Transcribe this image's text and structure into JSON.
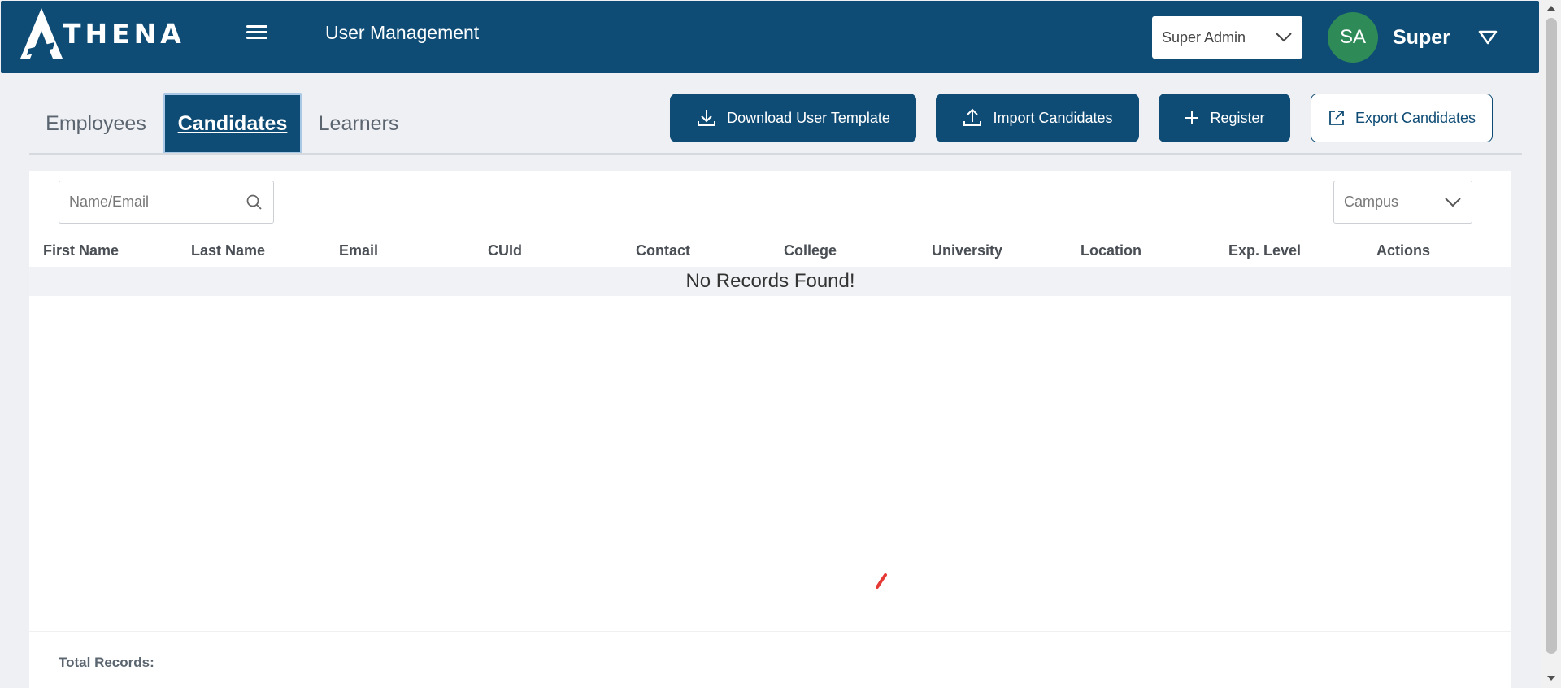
{
  "header": {
    "logo_text": "THENA",
    "title": "User Management",
    "role_select": {
      "value": "Super Admin"
    },
    "avatar_initials": "SA",
    "user_name": "Super"
  },
  "tabs": [
    {
      "label": "Employees",
      "active": false
    },
    {
      "label": "Candidates",
      "active": true
    },
    {
      "label": "Learners",
      "active": false
    }
  ],
  "toolbar": {
    "download_template": "Download User Template",
    "import": "Import Candidates",
    "register": "Register",
    "export": "Export Candidates"
  },
  "filters": {
    "search_placeholder": "Name/Email",
    "campus_value": "Campus"
  },
  "table": {
    "columns": [
      "First Name",
      "Last Name",
      "Email",
      "CUId",
      "Contact",
      "College",
      "University",
      "Location",
      "Exp. Level",
      "Actions"
    ],
    "empty_message": "No Records Found!"
  },
  "footer": {
    "total_label": "Total Records:"
  },
  "colors": {
    "primary": "#0f4c75",
    "avatar": "#2e8b57",
    "spinner": "#e53935"
  },
  "icons": [
    "hamburger-icon",
    "chevron-down-icon",
    "caret-down-icon",
    "download-icon",
    "upload-icon",
    "plus-icon",
    "external-link-icon",
    "search-icon",
    "spinner-icon"
  ]
}
